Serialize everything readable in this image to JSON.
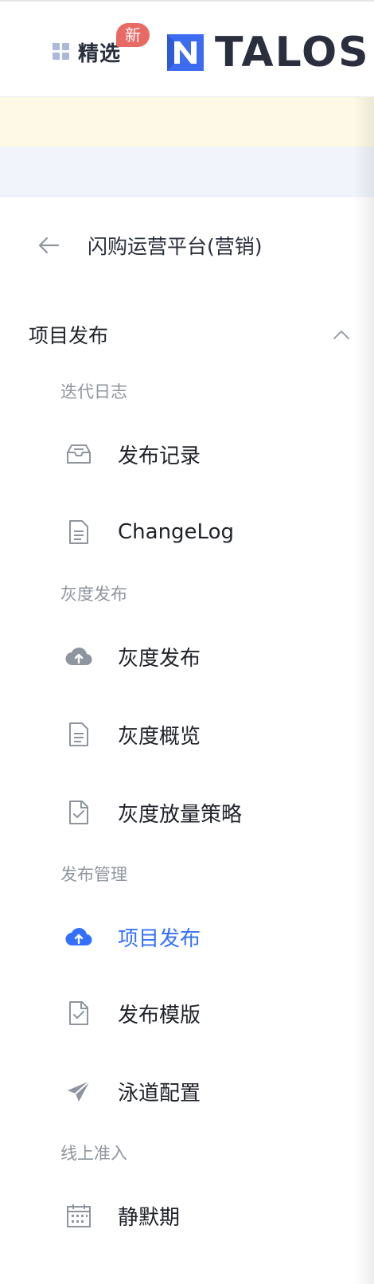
{
  "header": {
    "featured_label": "精选",
    "new_badge": "新",
    "logo_text": "TALOS"
  },
  "nav": {
    "back_title": "闪购运营平台(营销)",
    "section_title": "项目发布",
    "groups": [
      {
        "label": "迭代日志",
        "items": [
          {
            "label": "发布记录",
            "icon": "inbox-icon"
          },
          {
            "label": "ChangeLog",
            "icon": "document-icon"
          }
        ]
      },
      {
        "label": "灰度发布",
        "items": [
          {
            "label": "灰度发布",
            "icon": "cloud-upload-icon"
          },
          {
            "label": "灰度概览",
            "icon": "document-icon"
          },
          {
            "label": "灰度放量策略",
            "icon": "file-check-icon"
          }
        ]
      },
      {
        "label": "发布管理",
        "items": [
          {
            "label": "项目发布",
            "icon": "cloud-upload-icon",
            "active": true
          },
          {
            "label": "发布模版",
            "icon": "file-check-icon"
          },
          {
            "label": "泳道配置",
            "icon": "send-icon"
          }
        ]
      },
      {
        "label": "线上准入",
        "items": [
          {
            "label": "静默期",
            "icon": "calendar-icon"
          }
        ]
      }
    ]
  },
  "colors": {
    "accent": "#3370FF",
    "icon_gray": "#8F959E",
    "badge": "#E86A64",
    "notice_bg": "#FDF9E6",
    "strip_bg": "#F1F4FA"
  }
}
